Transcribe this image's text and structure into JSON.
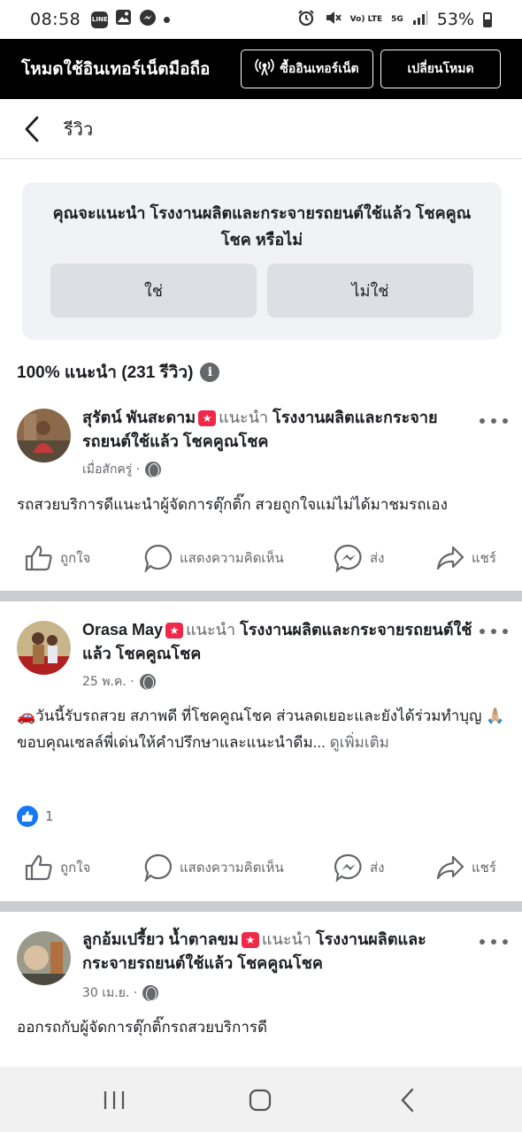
{
  "status_bar": {
    "time": "08:58",
    "icons_left": [
      "line-icon",
      "gallery-icon",
      "messenger-icon",
      "dot-icon"
    ],
    "icons_right": [
      "alarm-icon",
      "mute-icon",
      "volte-icon",
      "5g-icon",
      "signal-icon"
    ],
    "volte_label": "Vo) LTE",
    "network_label": "5G",
    "battery_percent": "53%"
  },
  "mode_banner": {
    "title": "โหมดใช้อินเทอร์เน็ตมือถือ",
    "buy_label": "ซื้ออินเทอร์เน็ต",
    "switch_label": "เปลี่ยนโหมด"
  },
  "header": {
    "title": "รีวิว"
  },
  "recommend_card": {
    "question": "คุณจะแนะนำ โรงงานผลิตและกระจายรถยนต์ใช้แล้ว โชคคูณโชค หรือไม่",
    "yes_label": "ใช่",
    "no_label": "ไม่ใช่"
  },
  "summary": {
    "text": "100% แนะนำ (231 รีวิว)"
  },
  "actions": {
    "like": "ถูกใจ",
    "comment": "แสดงความคิดเห็น",
    "send": "ส่ง",
    "share": "แชร์"
  },
  "reviews": [
    {
      "author": "สุรัตน์ พันสะดาม",
      "recommends": "แนะนำ",
      "page": "โรงงานผลิตและกระจายรถยนต์ใช้แล้ว โชคคูณโชค",
      "time": "เมื่อสักครู่ ·",
      "text": "รถสวยบริการดีแนะนำผู้จัดการตุ๊กติ๊ก สวยถูกใจแม่ไม่ได้มาชมรถเอง"
    },
    {
      "author": "Orasa May",
      "recommends": "แนะนำ",
      "page": "โรงงานผลิตและกระจายรถยนต์ใช้แล้ว โชคคูณโชค",
      "time": "25 พ.ค. ·",
      "text": "🚗วันนี้รับรถสวย สภาพดี ที่โชคคูณโชค ส่วนลดเยอะและยังได้ร่วมทำบุญ 🙏🏼ขอบคุณเซลล์พี่เด่นให้คำปรึกษาและแนะนำดีม...",
      "see_more": "ดูเพิ่มเติม",
      "likes": "1"
    },
    {
      "author": "ลูกอ้มเปรี้ยว น้ำตาลขม",
      "recommends": "แนะนำ",
      "page": "โรงงานผลิตและกระจายรถยนต์ใช้แล้ว โชคคูณโชค",
      "time": "30 เม.ย. ·",
      "text": "ออกรถกับผู้จัดการตุ๊กติ๊กรถสวยบริการดี"
    }
  ],
  "colors": {
    "banner_bg": "#000000",
    "card_bg": "#f0f2f5",
    "badge": "#f02849",
    "like_blue": "#1877f2",
    "separator": "#c9ccd1"
  }
}
